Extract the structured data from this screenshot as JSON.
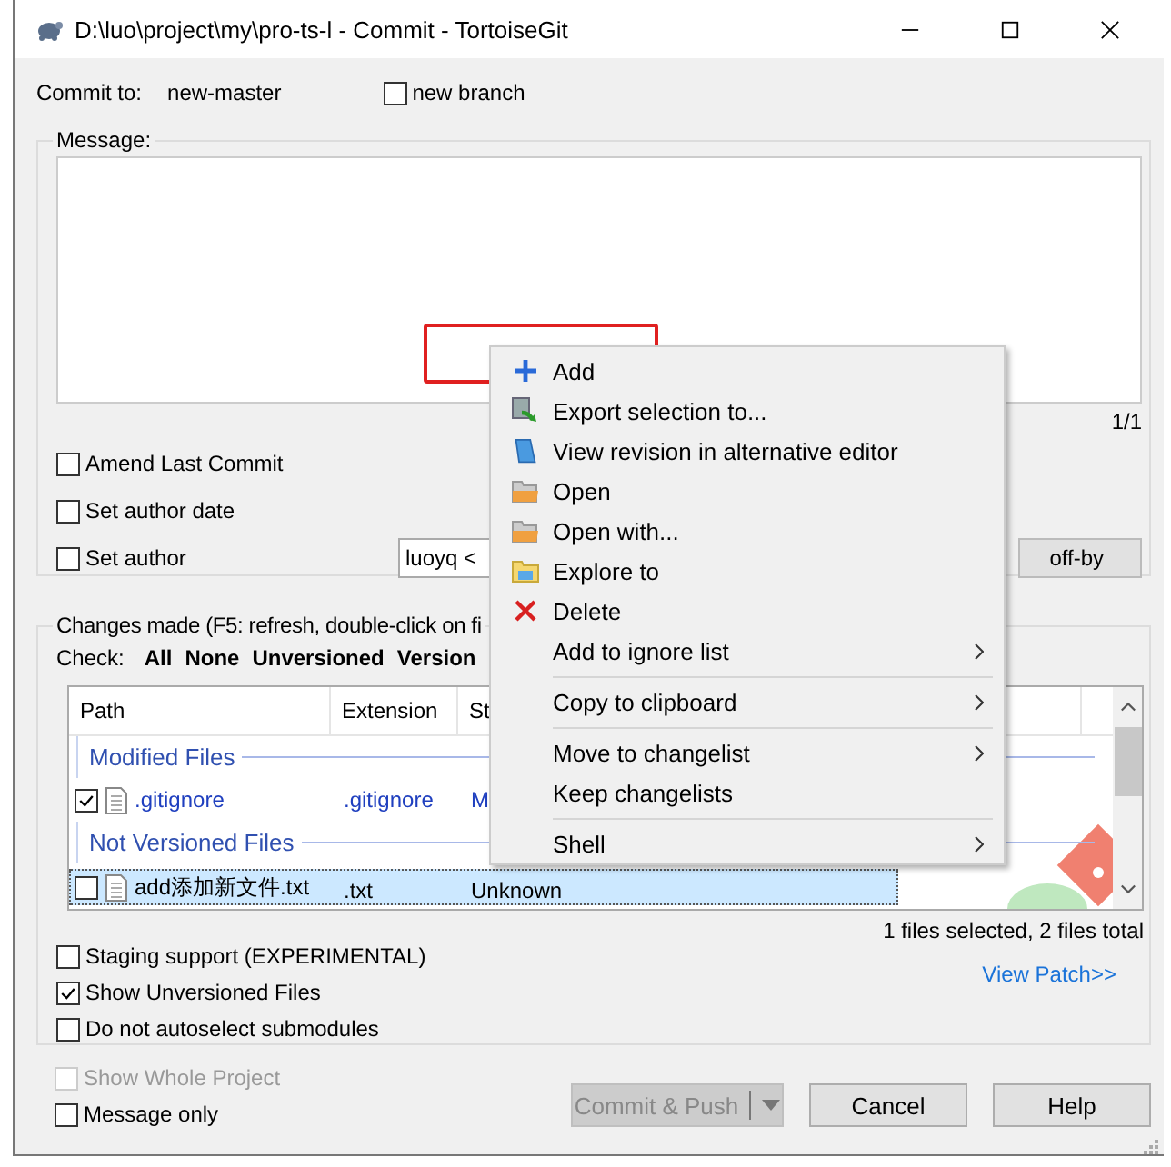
{
  "window": {
    "title": "D:\\luo\\project\\my\\pro-ts-l - Commit - TortoiseGit"
  },
  "commit_to": {
    "label": "Commit to:",
    "branch": "new-master"
  },
  "new_branch": {
    "label": "new branch",
    "checked": false
  },
  "message": {
    "legend": "Message:",
    "counter": "1/1",
    "author_value": "luoyq <",
    "signoff_button": "off-by",
    "options": [
      {
        "label": "Amend Last Commit",
        "checked": false
      },
      {
        "label": "Set author date",
        "checked": false
      },
      {
        "label": "Set author",
        "checked": false
      }
    ]
  },
  "changes": {
    "legend": "Changes made (F5: refresh, double-click on fi",
    "check_label": "Check:",
    "check_links": [
      "All",
      "None",
      "Unversioned",
      "Version"
    ],
    "columns": [
      "Path",
      "Extension",
      "St"
    ],
    "rows": [
      {
        "kind": "group",
        "label": "Modified Files"
      },
      {
        "kind": "file",
        "checked": true,
        "selected": false,
        "color": "#1f3fbf",
        "path": ".gitignore",
        "extension": ".gitignore",
        "status": "M"
      },
      {
        "kind": "group",
        "label": "Not Versioned Files"
      },
      {
        "kind": "file",
        "checked": false,
        "selected": true,
        "color": "#000000",
        "path": "add添加新文件.txt",
        "extension": ".txt",
        "status": "Unknown"
      }
    ],
    "summary": "1 files selected, 2 files total",
    "view_patch": "View Patch>>",
    "options": [
      {
        "label": "Staging support (EXPERIMENTAL)",
        "checked": false
      },
      {
        "label": "Show Unversioned Files",
        "checked": true
      },
      {
        "label": "Do not autoselect submodules",
        "checked": false
      }
    ]
  },
  "bottom_options": [
    {
      "label": "Show Whole Project",
      "checked": false,
      "disabled": true
    },
    {
      "label": "Message only",
      "checked": false,
      "disabled": false
    }
  ],
  "buttons": [
    {
      "label": "Commit & Push",
      "disabled": true,
      "split": true
    },
    {
      "label": "Cancel",
      "disabled": false,
      "split": false
    },
    {
      "label": "Help",
      "disabled": false,
      "split": false
    }
  ],
  "context_menu": {
    "items": [
      {
        "kind": "item",
        "label": "Add",
        "submenu": false
      },
      {
        "kind": "item",
        "label": "Export selection to...",
        "submenu": false
      },
      {
        "kind": "item",
        "label": "View revision in alternative editor",
        "submenu": false
      },
      {
        "kind": "item",
        "label": "Open",
        "submenu": false
      },
      {
        "kind": "item",
        "label": "Open with...",
        "submenu": false
      },
      {
        "kind": "item",
        "label": "Explore to",
        "submenu": false
      },
      {
        "kind": "item",
        "label": "Delete",
        "submenu": false
      },
      {
        "kind": "item",
        "label": "Add to ignore list",
        "submenu": true
      },
      {
        "kind": "separator"
      },
      {
        "kind": "item",
        "label": "Copy to clipboard",
        "submenu": true
      },
      {
        "kind": "separator"
      },
      {
        "kind": "item",
        "label": "Move to changelist",
        "submenu": true
      },
      {
        "kind": "item",
        "label": "Keep changelists",
        "submenu": false
      },
      {
        "kind": "separator"
      },
      {
        "kind": "item",
        "label": "Shell",
        "submenu": true
      }
    ]
  }
}
